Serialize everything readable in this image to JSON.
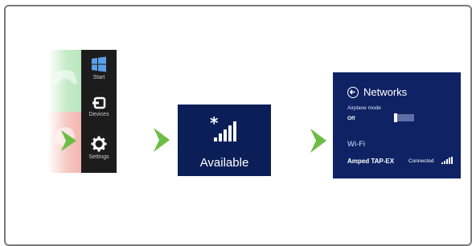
{
  "charms": {
    "items": [
      {
        "label": "Start",
        "icon": "windows-logo-icon"
      },
      {
        "label": "Devices",
        "icon": "devices-icon"
      },
      {
        "label": "Settings",
        "icon": "gear-icon"
      }
    ]
  },
  "available_tile": {
    "label": "Available",
    "icon": "network-signal-icon",
    "bg_color": "#0b1e57"
  },
  "networks_pane": {
    "title": "Networks",
    "airplane_mode_label": "Airplane mode",
    "airplane_mode_value": "Off",
    "wifi_heading": "Wi-Fi",
    "network_name": "Amped TAP-EX",
    "network_status": "Connected",
    "bg_color": "#0f2364"
  },
  "colors": {
    "arrow": "#6bbd45",
    "frame_border": "#7a7a7a"
  }
}
